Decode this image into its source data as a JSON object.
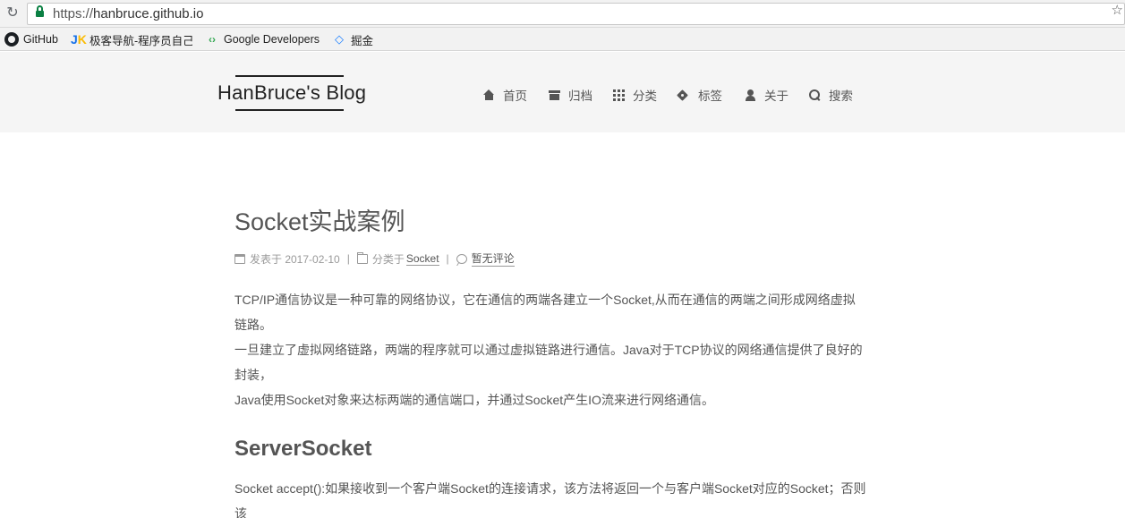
{
  "browser": {
    "url_scheme": "https://",
    "url_host": "hanbruce.github.io",
    "bookmarks": [
      {
        "label": "GitHub",
        "icon": "github-icon"
      },
      {
        "label": "极客导航-程序员自己",
        "icon": "jk-icon"
      },
      {
        "label": "Google Developers",
        "icon": "google-developers-icon"
      },
      {
        "label": "掘金",
        "icon": "juejin-icon"
      }
    ]
  },
  "site": {
    "brand": "HanBruce's Blog",
    "menu": [
      {
        "label": "首页",
        "icon": "home-icon"
      },
      {
        "label": "归档",
        "icon": "archive-icon"
      },
      {
        "label": "分类",
        "icon": "grid-icon"
      },
      {
        "label": "标签",
        "icon": "tags-icon"
      },
      {
        "label": "关于",
        "icon": "user-icon"
      },
      {
        "label": "搜索",
        "icon": "search-icon"
      }
    ]
  },
  "post": {
    "title": "Socket实战案例",
    "meta": {
      "posted_label": "发表于 2017-02-10",
      "category_prefix": "分类于",
      "category": "Socket",
      "comments": "暂无评论",
      "separator": "|"
    },
    "paragraphs": [
      "TCP/IP通信协议是一种可靠的网络协议，它在通信的两端各建立一个Socket,从而在通信的两端之间形成网络虚拟",
      "链路。",
      "一旦建立了虚拟网络链路，两端的程序就可以通过虚拟链路进行通信。Java对于TCP协议的网络通信提供了良好的",
      "封装，",
      "Java使用Socket对象来达标两端的通信端口，并通过Socket产生IO流来进行网络通信。"
    ],
    "section_heading": "ServerSocket",
    "section_paragraphs": [
      "Socket accept():如果接收到一个客户端Socket的连接请求，该方法将返回一个与客户端Socket对应的Socket；否则",
      "该"
    ]
  }
}
